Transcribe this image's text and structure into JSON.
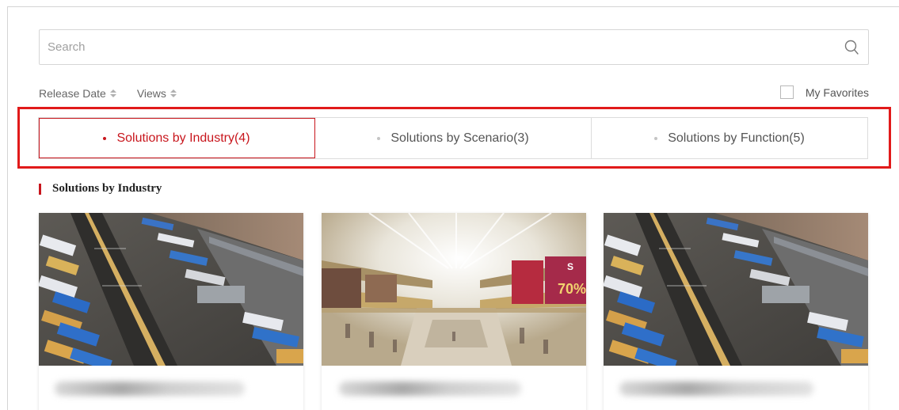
{
  "search": {
    "placeholder": "Search",
    "icon": "search-icon"
  },
  "sort": [
    {
      "label": "Release Date",
      "icon": "sort-updown-icon"
    },
    {
      "label": "Views",
      "icon": "sort-updown-icon"
    }
  ],
  "favorites": {
    "label": "My Favorites",
    "checked": false
  },
  "tabs": [
    {
      "label": "Solutions by Industry(4)",
      "active": true
    },
    {
      "label": "Solutions by Scenario(3)",
      "active": false
    },
    {
      "label": "Solutions by Function(5)",
      "active": false
    }
  ],
  "section": {
    "title": "Solutions by Industry"
  },
  "colors": {
    "accent": "#c8161d",
    "highlight_box": "#e11a1a",
    "border": "#dcdcdc"
  },
  "cards": [
    {
      "image": "logistics-warehouse-aerial-photo",
      "title_obscured": true
    },
    {
      "image": "shopping-mall-interior-photo",
      "title_obscured": true
    },
    {
      "image": "logistics-warehouse-aerial-photo",
      "title_obscured": true
    }
  ]
}
